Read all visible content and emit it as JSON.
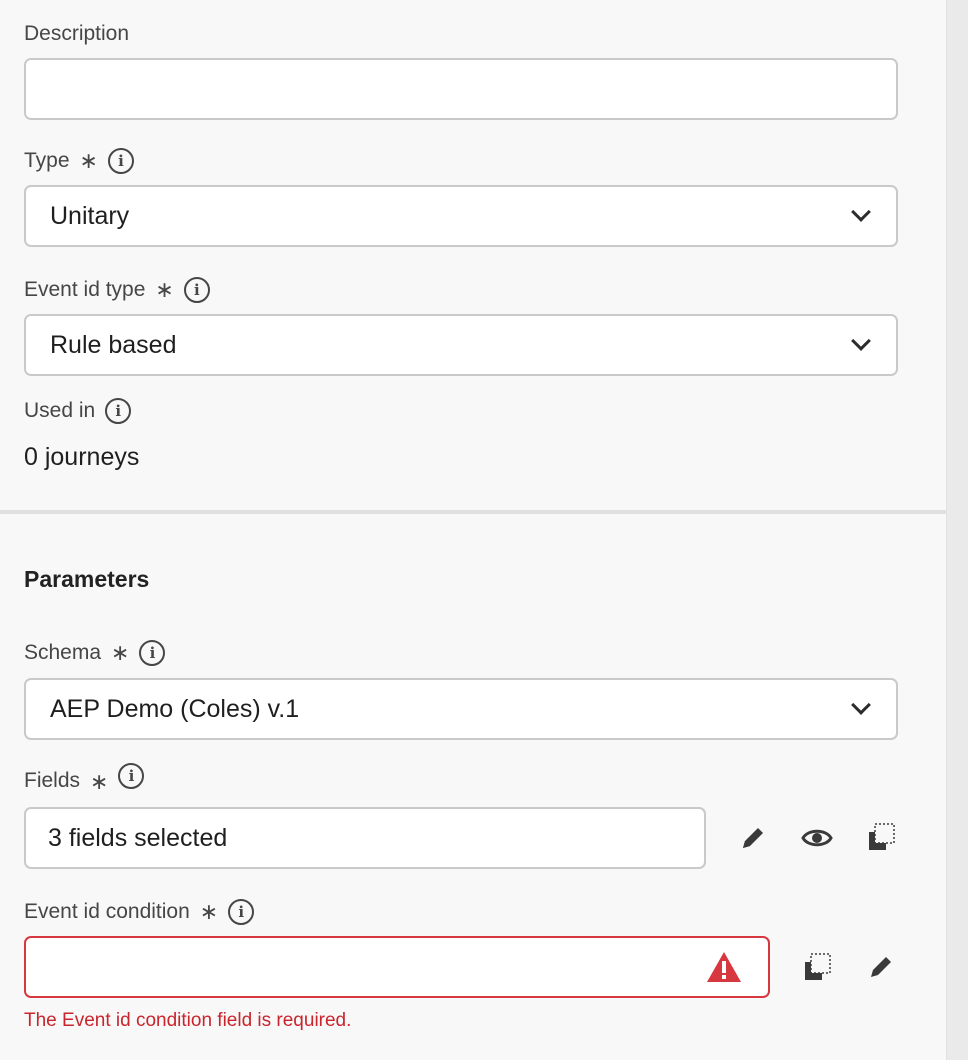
{
  "description": {
    "label": "Description",
    "value": ""
  },
  "type_field": {
    "label": "Type",
    "required_marker": "∗",
    "selected": "Unitary"
  },
  "event_id_type": {
    "label": "Event id type",
    "required_marker": "∗",
    "selected": "Rule based"
  },
  "used_in": {
    "label": "Used in",
    "value": "0 journeys"
  },
  "parameters": {
    "title": "Parameters",
    "schema": {
      "label": "Schema",
      "required_marker": "∗",
      "selected": "AEP Demo (Coles) v.1"
    },
    "fields": {
      "label": "Fields",
      "required_marker": "∗",
      "value": "3 fields selected"
    },
    "event_id_condition": {
      "label": "Event id condition",
      "required_marker": "∗",
      "value": "",
      "error_message": "The Event id condition field is required."
    }
  },
  "colors": {
    "error": "#d7373f",
    "background": "#f8f8f8",
    "field_border": "#c9c9c9"
  },
  "icons": {
    "info": "info-icon",
    "chevron": "chevron-down-icon",
    "edit": "pencil-icon",
    "preview": "eye-icon",
    "copy": "copy-icon",
    "alert": "alert-triangle-icon"
  }
}
